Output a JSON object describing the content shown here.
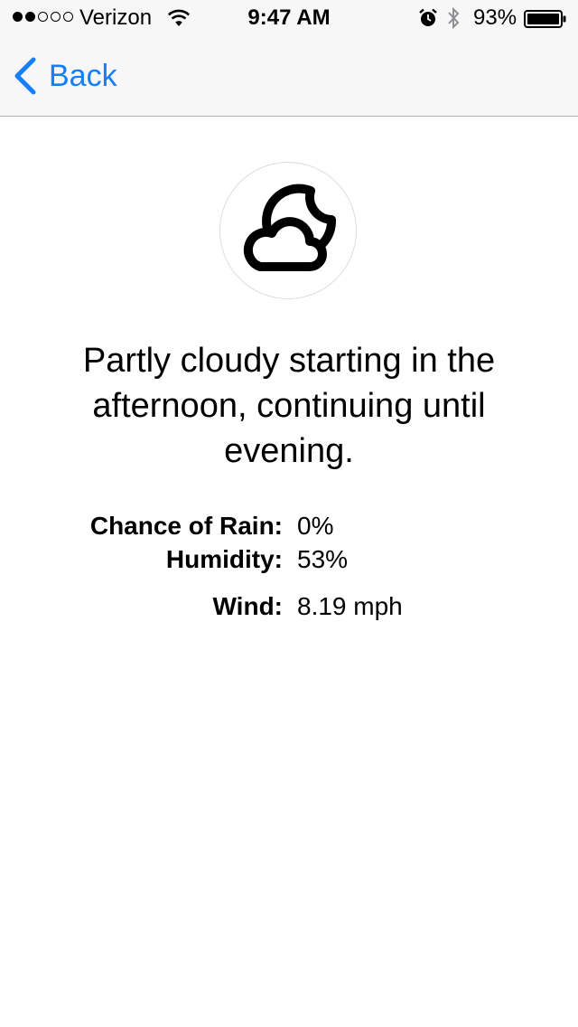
{
  "status_bar": {
    "carrier": "Verizon",
    "time": "9:47 AM",
    "battery_percent": "93%",
    "signal_bars_filled": 2,
    "signal_bars_total": 5,
    "icons": [
      "wifi-icon",
      "alarm-icon",
      "bluetooth-icon",
      "battery-icon"
    ]
  },
  "nav": {
    "back_label": "Back"
  },
  "weather": {
    "icon": "partly-cloudy-night-icon",
    "summary": "Partly cloudy starting in the afternoon, continuing until evening.",
    "details": [
      {
        "label": "Chance of Rain:",
        "value": "0%"
      },
      {
        "label": "Humidity:",
        "value": "53%"
      },
      {
        "label": "Wind:",
        "value": "8.19 mph"
      }
    ]
  },
  "colors": {
    "accent": "#157efb",
    "nav_background": "#f7f7f7"
  }
}
